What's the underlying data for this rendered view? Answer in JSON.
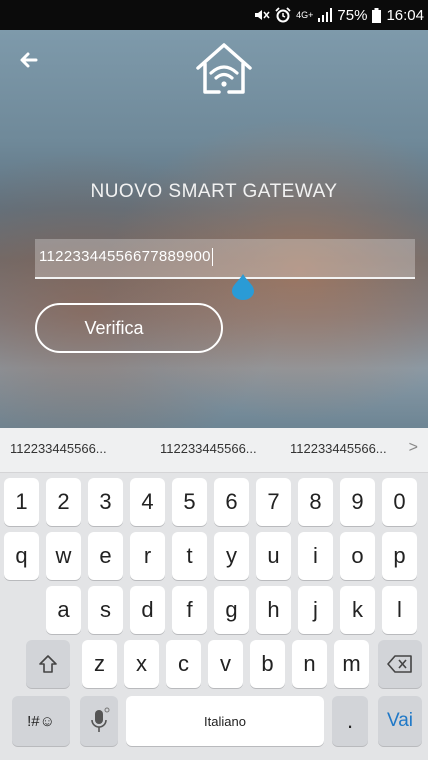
{
  "status": {
    "battery": "75%",
    "time": "16:04",
    "network": "4G+"
  },
  "app": {
    "title": "NUOVO SMART GATEWAY",
    "code_value": "11223344556677889900",
    "verify_label": "Verifica"
  },
  "keyboard": {
    "suggestions": [
      "112233445566...",
      "112233445566...",
      "112233445566..."
    ],
    "suggestion_more": ">",
    "row1": [
      "1",
      "2",
      "3",
      "4",
      "5",
      "6",
      "7",
      "8",
      "9",
      "0"
    ],
    "row2": [
      "q",
      "w",
      "e",
      "r",
      "t",
      "y",
      "u",
      "i",
      "o",
      "p"
    ],
    "row3": [
      "a",
      "s",
      "d",
      "f",
      "g",
      "h",
      "j",
      "k",
      "l"
    ],
    "row4": [
      "z",
      "x",
      "c",
      "v",
      "b",
      "n",
      "m"
    ],
    "symbols_label": "!#☺",
    "space_label": "Italiano",
    "period_label": ".",
    "go_label": "Vai"
  },
  "colors": {
    "accent": "#2a9bd6",
    "go_text": "#1f78c7"
  }
}
